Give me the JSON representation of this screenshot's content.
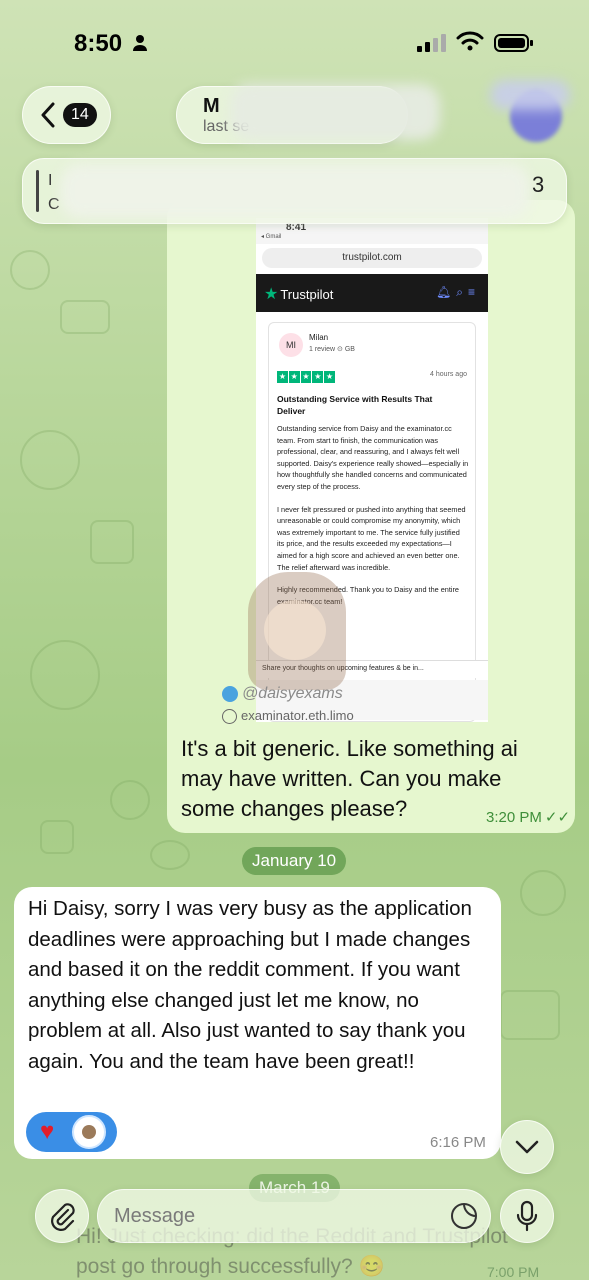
{
  "status_bar": {
    "time": "8:50"
  },
  "header": {
    "back_badge": "14",
    "chat_name": "M",
    "chat_status": "last se",
    "pinned_letter_a": "I",
    "pinned_letter_b": "C",
    "pinned_count": "3"
  },
  "screenshot": {
    "time": "8:41",
    "source_app": "◂ Gmail",
    "url": "trustpilot.com",
    "brand": "Trustpilot",
    "reviewer_initials": "MI",
    "reviewer_name": "Milan",
    "reviewer_meta": "1 review  ⊙ GB",
    "ago": "4 hours ago",
    "review_title": "Outstanding Service with Results That Deliver",
    "review_p1": "Outstanding service from Daisy and the examinator.cc team. From start to finish, the communication was professional, clear, and reassuring, and I always felt well supported. Daisy's experience really showed—especially in how thoughtfully she handled concerns and communicated every step of the process.",
    "review_p2": "I never felt pressured or pushed into anything that seemed unreasonable or could compromise my anonymity, which was extremely important to me. The service fully justified its price, and the results exceeded my expectations—I aimed for a high score and achieved an even better one. The relief afterward was incredible.",
    "review_p3": "Highly recommended. Thank you to Daisy and the entire examinator.cc team!",
    "share_banner": "Share your thoughts on upcoming features & be in...",
    "watermark_handle": "@daisyexams",
    "watermark_site": "examinator.eth.limo"
  },
  "messages": {
    "outgoing_text": "It's a bit generic. Like something ai may have written. Can you make some changes please?",
    "outgoing_time": "3:20 PM",
    "date_1": "January 10",
    "incoming_text": "Hi Daisy, sorry I was very busy as the application deadlines were approaching but I made changes and based it on the reddit comment. If you want anything else changed just let me know, no problem at all. Also just wanted to say thank you again. You and the team have been great!!",
    "incoming_time": "6:16 PM",
    "date_2": "March 19",
    "faded_text_1": "Hi! Just checking: did the Reddit and Trustpilot",
    "faded_text_2": "post go through successfully? 😊",
    "faded_time": "7:00 PM"
  },
  "composer": {
    "placeholder": "Message"
  },
  "colors": {
    "accent_green": "#3f8f3a",
    "trustpilot_green": "#00b67a",
    "bubble_out": "#e6f7cf"
  }
}
